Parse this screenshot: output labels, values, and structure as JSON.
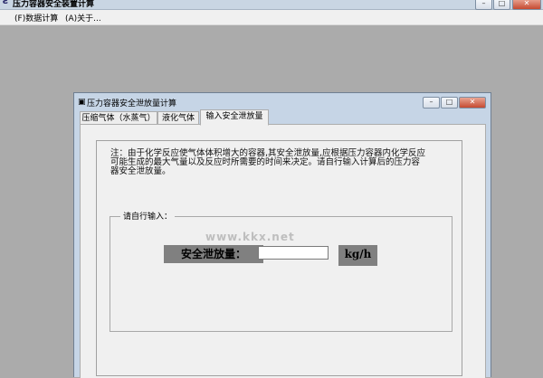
{
  "window": {
    "title": "压力容器安全装置计算",
    "controls": {
      "minimize": "–",
      "maximize": "□",
      "close": "✕"
    }
  },
  "menu": {
    "items": [
      "(F)数据计算",
      "(A)关于..."
    ]
  },
  "child_window": {
    "title": "压力容器安全泄放量计算",
    "controls": {
      "minimize": "–",
      "maximize": "□",
      "close": "✕"
    },
    "tabs": [
      "压缩气体（水蒸气）",
      "液化气体",
      "输入安全泄放量"
    ],
    "active_tab": 2,
    "note": "注：由于化学反应使气体体积增大的容器,其安全泄放量,应根据压力容器内化学反应可能生成的最大气量以及反应时所需要的时间来决定。请自行输入计算后的压力容器安全泄放量。",
    "group_label": "请自行输入：",
    "volume_label": "安全泄放量：",
    "volume_value": "",
    "unit": "kg/h",
    "watermark": "www.kkx.net"
  },
  "icons": {
    "app": "app-icon",
    "child": "document-icon"
  }
}
